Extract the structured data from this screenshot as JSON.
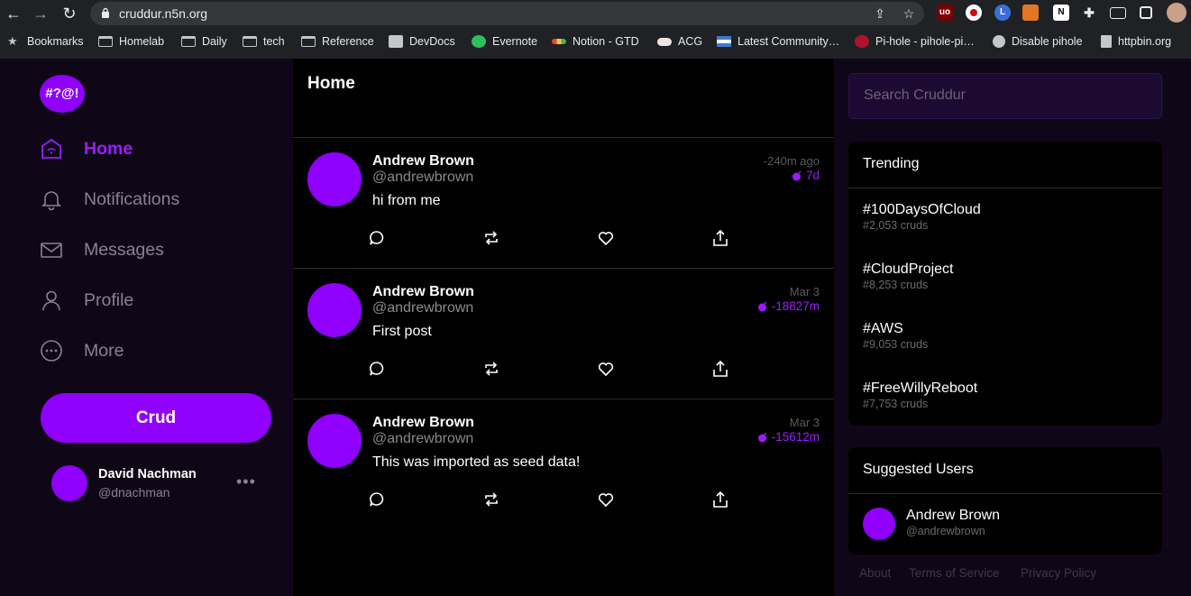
{
  "browser": {
    "url": "cruddur.n5n.org",
    "bookmarks": [
      {
        "label": "Bookmarks",
        "icon": "star-icon"
      },
      {
        "label": "Homelab",
        "icon": "folder-icon"
      },
      {
        "label": "Daily",
        "icon": "folder-icon"
      },
      {
        "label": "tech",
        "icon": "folder-icon"
      },
      {
        "label": "Reference",
        "icon": "folder-icon"
      },
      {
        "label": "DevDocs",
        "icon": "devdocs-icon"
      },
      {
        "label": "Evernote",
        "icon": "evernote-icon"
      },
      {
        "label": "Notion - GTD",
        "icon": "notion-icon"
      },
      {
        "label": "ACG",
        "icon": "cloud-icon"
      },
      {
        "label": "Latest Community…",
        "icon": "community-icon"
      },
      {
        "label": "Pi-hole - pihole-pi…",
        "icon": "pihole-icon"
      },
      {
        "label": "Disable pihole",
        "icon": "globe-icon"
      },
      {
        "label": "httpbin.org",
        "icon": "trash-icon"
      }
    ]
  },
  "app": {
    "logo_text": "#?@!",
    "nav": [
      {
        "label": "Home",
        "icon": "home-icon",
        "active": true
      },
      {
        "label": "Notifications",
        "icon": "bell-icon"
      },
      {
        "label": "Messages",
        "icon": "envelope-icon"
      },
      {
        "label": "Profile",
        "icon": "user-icon"
      },
      {
        "label": "More",
        "icon": "more-circle-icon"
      }
    ],
    "crud_button": "Crud",
    "current_user": {
      "name": "David Nachman",
      "handle": "@dnachman",
      "menu": "•••"
    }
  },
  "feed": {
    "title": "Home",
    "posts": [
      {
        "name": "Andrew Brown",
        "handle": "@andrewbrown",
        "body": "hi from me",
        "time": "-240m ago",
        "expiry": "7d"
      },
      {
        "name": "Andrew Brown",
        "handle": "@andrewbrown",
        "body": "First post",
        "time": "Mar 3",
        "expiry": "-18827m"
      },
      {
        "name": "Andrew Brown",
        "handle": "@andrewbrown",
        "body": "This was imported as seed data!",
        "time": "Mar 3",
        "expiry": "-15612m"
      }
    ],
    "actions": [
      "reply-icon",
      "repost-icon",
      "like-icon",
      "share-icon"
    ]
  },
  "sidebar_right": {
    "search_placeholder": "Search Cruddur",
    "trending_title": "Trending",
    "trending": [
      {
        "tag": "#100DaysOfCloud",
        "count": "#2,053 cruds"
      },
      {
        "tag": "#CloudProject",
        "count": "#8,253 cruds"
      },
      {
        "tag": "#AWS",
        "count": "#9,053 cruds"
      },
      {
        "tag": "#FreeWillyReboot",
        "count": "#7,753 cruds"
      }
    ],
    "suggested_title": "Suggested Users",
    "suggested": [
      {
        "name": "Andrew Brown",
        "handle": "@andrewbrown"
      }
    ],
    "footer": [
      "About",
      "Terms of Service",
      "Privacy Policy"
    ]
  },
  "colors": {
    "accent": "#8f00ff",
    "sidebar_bg": "#0f0717",
    "feed_bg": "#000000"
  }
}
